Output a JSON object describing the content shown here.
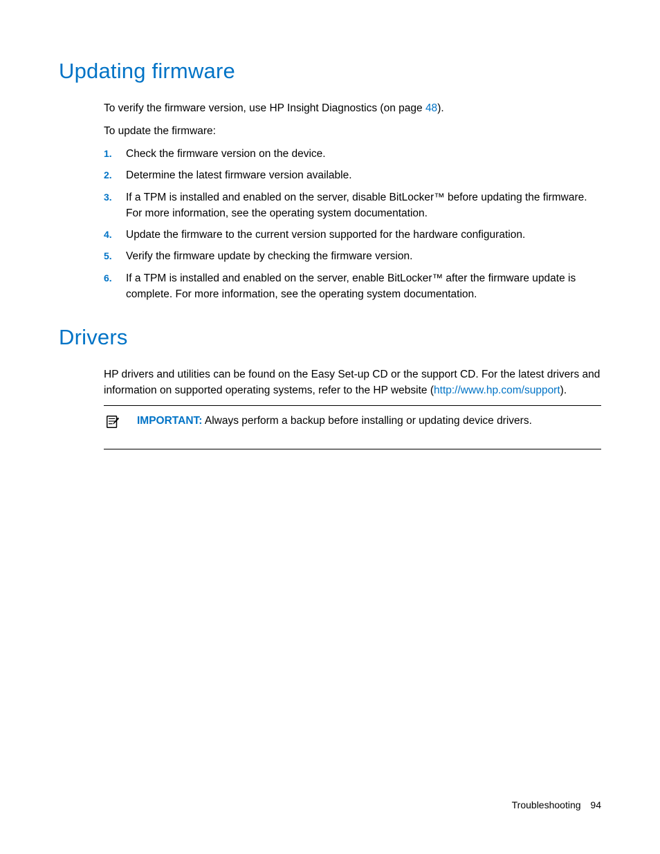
{
  "section1": {
    "heading": "Updating firmware",
    "intro_pre": "To verify the firmware version, use HP Insight Diagnostics (on page ",
    "intro_link": "48",
    "intro_post": ").",
    "para2": "To update the firmware:",
    "steps": [
      {
        "num": "1.",
        "text": "Check the firmware version on the device."
      },
      {
        "num": "2.",
        "text": "Determine the latest firmware version available."
      },
      {
        "num": "3.",
        "text": "If a TPM is installed and enabled on the server, disable BitLocker™ before updating the firmware. For more information, see the operating system documentation."
      },
      {
        "num": "4.",
        "text": "Update the firmware to the current version supported for the hardware configuration."
      },
      {
        "num": "5.",
        "text": "Verify the firmware update by checking the firmware version."
      },
      {
        "num": "6.",
        "text": "If a TPM is installed and enabled on the server, enable BitLocker™ after the firmware update is complete. For more information, see the operating system documentation."
      }
    ]
  },
  "section2": {
    "heading": "Drivers",
    "para_pre": "HP drivers and utilities can be found on the Easy Set-up CD or the support CD. For the latest drivers and information on supported operating systems, refer to the HP website (",
    "para_link": "http://www.hp.com/support",
    "para_post": ").",
    "important_label": "IMPORTANT:",
    "important_text": "  Always perform a backup before installing or updating device drivers."
  },
  "footer": {
    "section": "Troubleshooting",
    "page": "94"
  }
}
